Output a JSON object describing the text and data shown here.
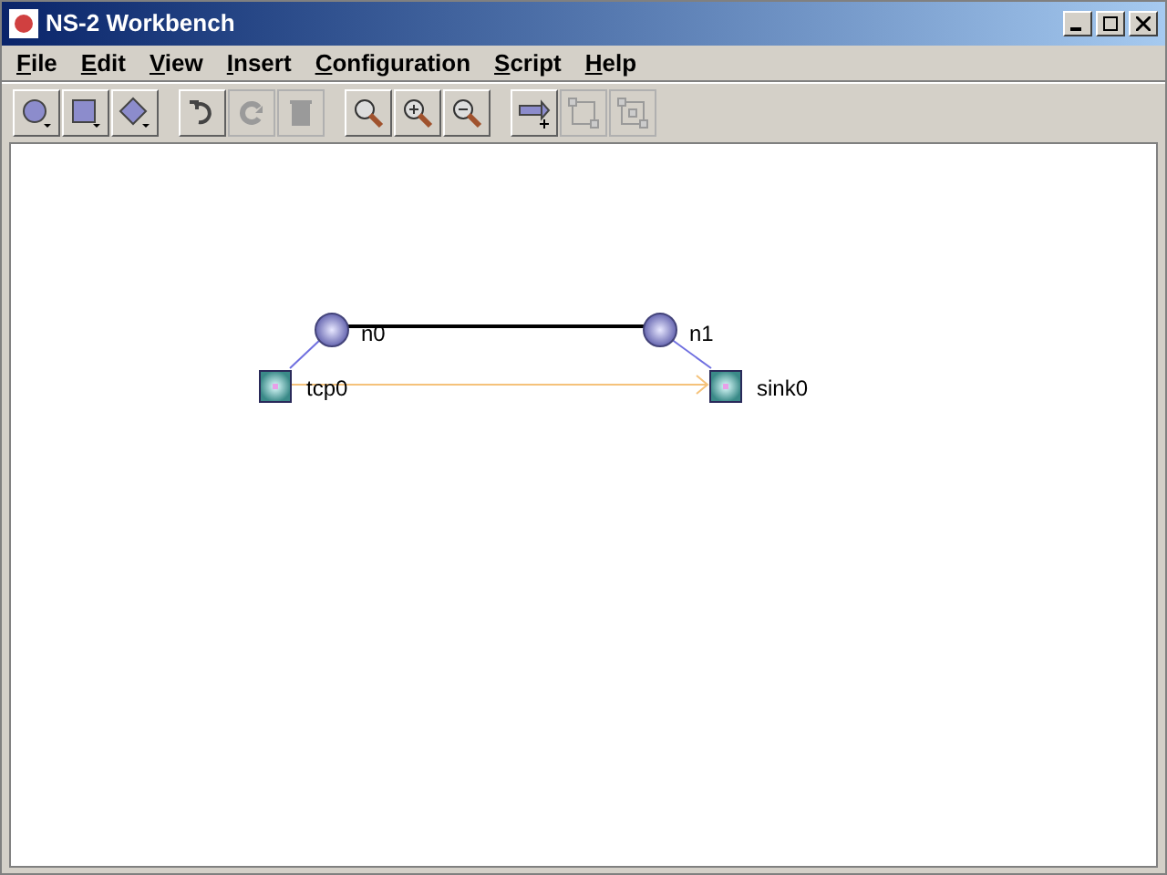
{
  "window": {
    "title": "NS-2 Workbench"
  },
  "menu": [
    {
      "label": "File"
    },
    {
      "label": "Edit"
    },
    {
      "label": "View"
    },
    {
      "label": "Insert"
    },
    {
      "label": "Configuration"
    },
    {
      "label": "Script"
    },
    {
      "label": "Help"
    }
  ],
  "toolbar": [
    [
      {
        "kind": "circle",
        "disabled": false
      },
      {
        "kind": "square",
        "disabled": false
      },
      {
        "kind": "diamond",
        "disabled": false
      }
    ],
    [
      {
        "kind": "undo",
        "disabled": false
      },
      {
        "kind": "redo",
        "disabled": true
      },
      {
        "kind": "delete",
        "disabled": true
      }
    ],
    [
      {
        "kind": "zoom",
        "disabled": false
      },
      {
        "kind": "zoom-in",
        "disabled": false
      },
      {
        "kind": "zoom-out",
        "disabled": false
      }
    ],
    [
      {
        "kind": "add-link",
        "disabled": false
      },
      {
        "kind": "group",
        "disabled": true
      },
      {
        "kind": "ungroup",
        "disabled": true
      }
    ]
  ],
  "nodes": [
    {
      "kind": "node",
      "label": "n0"
    },
    {
      "kind": "node",
      "label": "n1"
    },
    {
      "kind": "agent",
      "label": "tcp0"
    },
    {
      "kind": "agent",
      "label": "sink0"
    }
  ],
  "edges": [
    {
      "kind": "link"
    },
    {
      "kind": "attach"
    },
    {
      "kind": "attach"
    },
    {
      "kind": "flow"
    }
  ]
}
